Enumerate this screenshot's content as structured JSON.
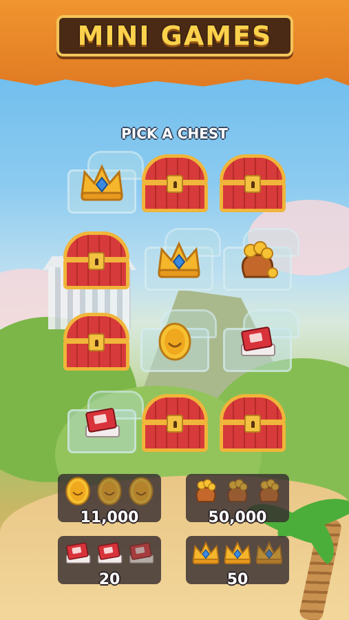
{
  "header": {
    "title": "MINI GAMES"
  },
  "board": {
    "prompt": "PICK A CHEST",
    "slots": [
      {
        "state": "open",
        "prize": "crown-icon"
      },
      {
        "state": "closed"
      },
      {
        "state": "closed"
      },
      {
        "state": "closed"
      },
      {
        "state": "open",
        "prize": "crown-icon"
      },
      {
        "state": "open",
        "prize": "coin-bag-icon"
      },
      {
        "state": "closed"
      },
      {
        "state": "open",
        "prize": "coin-icon"
      },
      {
        "state": "open",
        "prize": "card-stack-icon"
      },
      {
        "state": "open",
        "prize": "card-stack-icon"
      },
      {
        "state": "closed"
      },
      {
        "state": "closed"
      }
    ]
  },
  "rewards": [
    {
      "type": "coins",
      "icon": "coin-icon",
      "amount": "11,000",
      "found": 1,
      "needed": 3
    },
    {
      "type": "coin-bags",
      "icon": "coin-bag-icon",
      "amount": "50,000",
      "found": 1,
      "needed": 3
    },
    {
      "type": "cards",
      "icon": "card-stack-icon",
      "amount": "20",
      "found": 2,
      "needed": 3
    },
    {
      "type": "crowns",
      "icon": "crown-icon",
      "amount": "50",
      "found": 2,
      "needed": 3
    }
  ],
  "colors": {
    "banner": "#e8862a",
    "title_text": "#fcd24d",
    "chest_red": "#d73a3a",
    "chest_gold": "#f0b53a"
  }
}
